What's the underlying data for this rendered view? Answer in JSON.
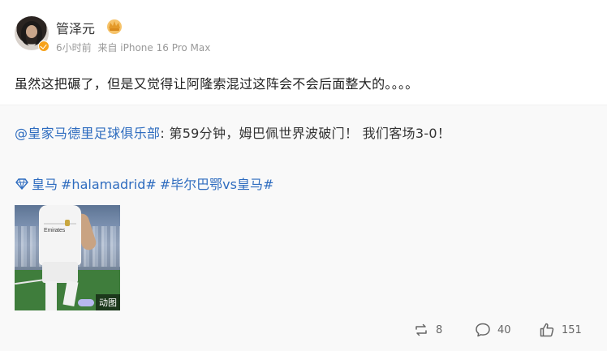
{
  "user": {
    "name": "管泽元",
    "meta_time": "6小时前",
    "meta_source": "来自 iPhone 16 Pro Max"
  },
  "post": {
    "text": "虽然这把碾了，但是又觉得让阿隆索混过这阵会不会后面整大的。。。。"
  },
  "repost": {
    "mention": "@皇家马德里足球俱乐部",
    "text": ": 第59分钟，姆巴佩世界波破门！ 我们客场3-0！",
    "tags": [
      "皇马",
      "#halamadrid#",
      "#毕尔巴鄂vs皇马#"
    ],
    "media_badge": "动图",
    "jersey_brand": "Emirates"
  },
  "actions": {
    "repost_count": "8",
    "comment_count": "40",
    "like_count": "151"
  },
  "colors": {
    "link": "#2e6cbf",
    "muted": "#999999",
    "badge": "#f7a21b"
  },
  "icons": {
    "verify": "verified-badge-icon",
    "vip": "crown-icon",
    "topic": "diamond-icon",
    "repost": "repost-icon",
    "comment": "comment-icon",
    "like": "thumbs-up-icon"
  }
}
